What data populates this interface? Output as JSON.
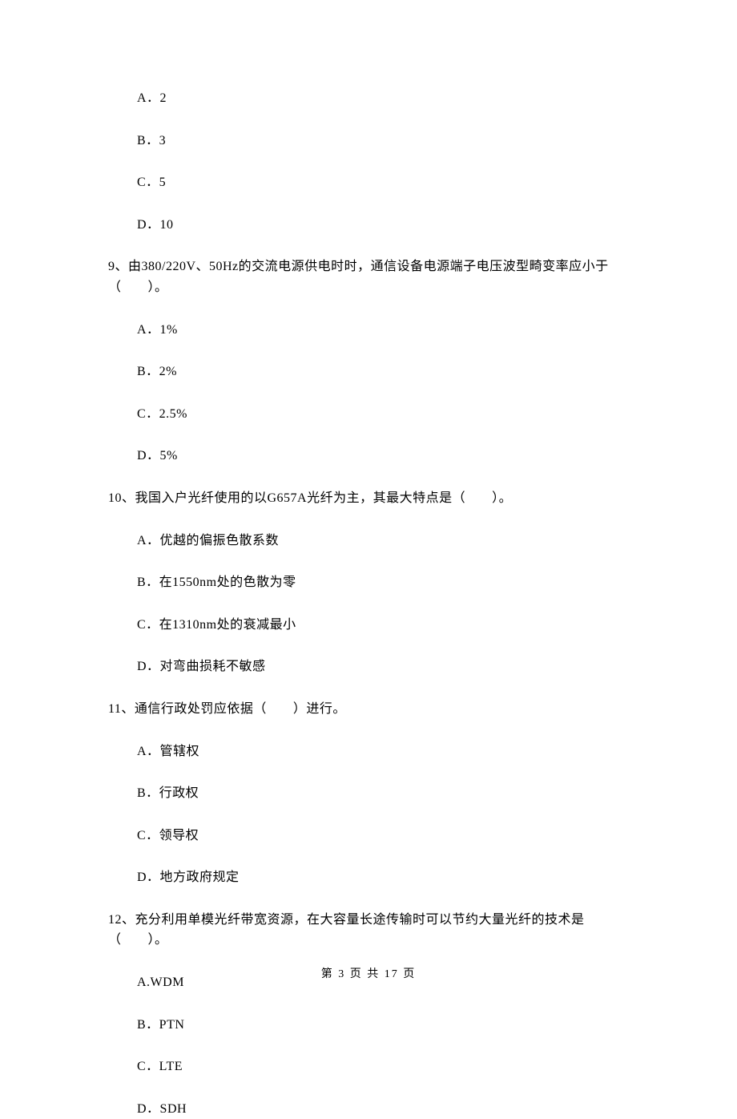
{
  "q8_options": {
    "a": "A．2",
    "b": "B．3",
    "c": "C．5",
    "d": "D．10"
  },
  "q9": {
    "text": "9、由380/220V、50Hz的交流电源供电时时，通信设备电源端子电压波型畸变率应小于（　　）。",
    "a": "A．1%",
    "b": "B．2%",
    "c": "C．2.5%",
    "d": "D．5%"
  },
  "q10": {
    "text": "10、我国入户光纤使用的以G657A光纤为主，其最大特点是（　　）。",
    "a": "A．优越的偏振色散系数",
    "b": "B．在1550nm处的色散为零",
    "c": "C．在1310nm处的衰减最小",
    "d": "D．对弯曲损耗不敏感"
  },
  "q11": {
    "text": "11、通信行政处罚应依据（　　）进行。",
    "a": "A．管辖权",
    "b": "B．行政权",
    "c": "C．领导权",
    "d": "D．地方政府规定"
  },
  "q12": {
    "text": "12、充分利用单模光纤带宽资源，在大容量长途传输时可以节约大量光纤的技术是（　　）。",
    "a": "A.WDM",
    "b": "B．PTN",
    "c": "C．LTE",
    "d": "D．SDH"
  },
  "footer": "第 3 页 共 17 页"
}
